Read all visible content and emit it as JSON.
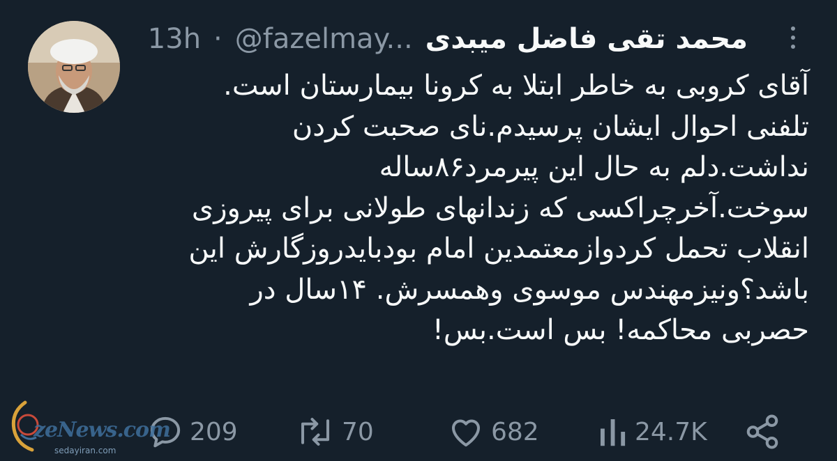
{
  "tweet": {
    "display_name": "محمد تقی فاضل میبدی",
    "handle": "@fazelmay...",
    "separator": "·",
    "time": "13h",
    "body_lines": [
      "آقای کروبی به خاطر ابتلا به کرونا بیمارستان است.",
      "تلفنی احوال ایشان پرسیدم.نای صحبت کردن",
      "نداشت.دلم به حال این پیرمرد۸۶ساله",
      "سوخت.آخرچراکسی که زندانهای طولانی برای پیروزی",
      "انقلاب تحمل کردوازمعتمدین امام بودبایدروزگارش این",
      "باشد؟ونیزمهندس موسوی وهمسرش. ۱۴سال در",
      "حصربی محاکمه! بس است.بس!"
    ]
  },
  "actions": {
    "replies": "209",
    "retweets": "70",
    "likes": "682",
    "views": "24.7K"
  },
  "icons": {
    "more": "more-vertical-icon",
    "reply": "reply-icon",
    "retweet": "retweet-icon",
    "like": "heart-icon",
    "views": "views-chart-icon",
    "share": "share-icon"
  },
  "watermark": {
    "main": "zeNews.com",
    "sub": "sedayiran.com"
  },
  "colors": {
    "background": "#15202b",
    "text": "#f7f9f9",
    "secondary": "#8b98a5"
  }
}
